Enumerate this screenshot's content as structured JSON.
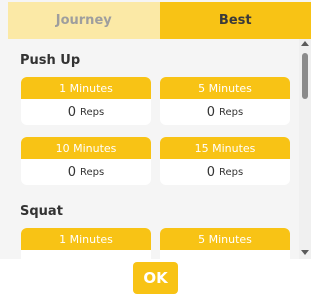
{
  "tabs": [
    {
      "label": "Journey"
    },
    {
      "label": "Best"
    }
  ],
  "sections": [
    {
      "title": "Push Up",
      "cards": [
        {
          "label": "1 Minutes",
          "value": "0",
          "unit": "Reps"
        },
        {
          "label": "5 Minutes",
          "value": "0",
          "unit": "Reps"
        },
        {
          "label": "10 Minutes",
          "value": "0",
          "unit": "Reps"
        },
        {
          "label": "15 Minutes",
          "value": "0",
          "unit": "Reps"
        }
      ]
    },
    {
      "title": "Squat",
      "cards": [
        {
          "label": "1 Minutes"
        },
        {
          "label": "5 Minutes"
        }
      ]
    }
  ],
  "footer": {
    "ok_label": "OK"
  },
  "colors": {
    "accent": "#f8c315",
    "tab_inactive": "#fbe9a6"
  }
}
